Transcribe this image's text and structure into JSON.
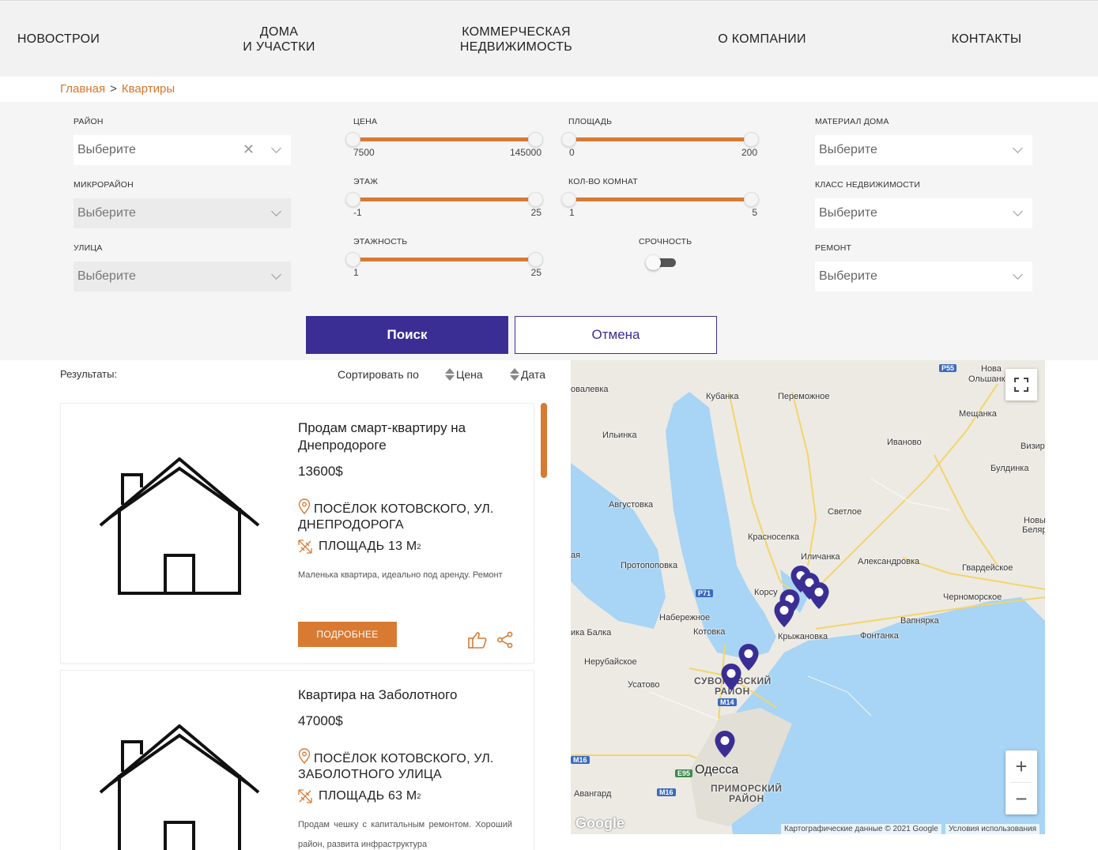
{
  "nav": {
    "items": [
      "НОВОСТРОИ",
      "ДОМА\nИ УЧАСТКИ",
      "КОММЕРЧЕСКАЯ\nНЕДВИЖИМОСТЬ",
      "О КОМПАНИИ",
      "КОНТАКТЫ"
    ]
  },
  "breadcrumb": {
    "home": "Главная",
    "sep": ">",
    "current": "Квартиры"
  },
  "filters": {
    "district": {
      "label": "РАЙОН",
      "value": "Выберите"
    },
    "microdistrict": {
      "label": "МИКРОРАЙОН",
      "value": "Выберите"
    },
    "street": {
      "label": "УЛИЦА",
      "value": "Выберите"
    },
    "price": {
      "label": "ЦЕНА",
      "min": "7500",
      "max": "145000"
    },
    "floor": {
      "label": "ЭТАЖ",
      "min": "-1",
      "max": "25"
    },
    "floors_total": {
      "label": "ЭТАЖНОСТЬ",
      "min": "1",
      "max": "25"
    },
    "area": {
      "label": "ПЛОЩАДЬ",
      "min": "0",
      "max": "200"
    },
    "rooms": {
      "label": "КОЛ-ВО КОМНАТ",
      "min": "1",
      "max": "5"
    },
    "urgent": {
      "label": "СРОЧНОСТЬ",
      "on": false
    },
    "material": {
      "label": "МАТЕРИАЛ ДОМА",
      "value": "Выберите"
    },
    "class": {
      "label": "КЛАСС НЕДВИЖИМОСТИ",
      "value": "Выберите"
    },
    "repair": {
      "label": "РЕМОНТ",
      "value": "Выберите"
    },
    "search_label": "Поиск",
    "cancel_label": "Отмена"
  },
  "results": {
    "label": "Результаты:",
    "sort_label": "Сортировать по",
    "sort_price": "Цена",
    "sort_date": "Дата",
    "accent": "#d97a33",
    "items": [
      {
        "title": "Продам смарт-квартиру на Днепродороге",
        "price": "13600$",
        "address": "ПОСЁЛОК КОТОВСКОГО, УЛ. ДНЕПРОДОРОГА",
        "area": "ПЛОЩАДЬ 13 М",
        "area_sup": "2",
        "desc": "Маленька квартира, идеально под аренду. Ремонт",
        "more": "ПОДРОБНЕЕ"
      },
      {
        "title": "Квартира на Заболотного",
        "price": "47000$",
        "address": "ПОСЁЛОК КОТОВСКОГО, УЛ. ЗАБОЛОТНОГО УЛИЦА",
        "area": "ПЛОЩАДЬ 63 М",
        "area_sup": "2",
        "desc": "Продам чешку с капитальным ремонтом. Хороший район, развита инфраструктура",
        "more": "ПОДРОБНЕЕ"
      }
    ]
  },
  "map": {
    "places": {
      "p55": "P55",
      "nova": "Нова",
      "olshanka": "Ольшанка",
      "valevka": "овалевка",
      "kubanka": "Кубанка",
      "peremozhnoe": "Переможное",
      "meshchanka": "Мещанка",
      "ilyinka": "Ильинка",
      "ivanovo": "Иваново",
      "vizir": "Визир",
      "buldinka": "Булдинка",
      "avgustovka": "Августовка",
      "svetloe": "Светлое",
      "novy": "Новы",
      "belyar": "Беляр",
      "krasnoselka": "Красноселка",
      "ilichanka": "Иличанка",
      "aleksandrovka": "Александровка",
      "aya": "ая",
      "protopopovka": "Протопоповка",
      "gvardeyskoe": "Гвардейское",
      "p71": "P71",
      "korsu": "Корсу",
      "chernomorskoe": "Черноморское",
      "naberezhnoe": "Набережное",
      "vapnyarka": "Вапнярка",
      "kotovka": "Котовка",
      "kryzhanovka": "Крыжановка",
      "fontanka": "Фонтанка",
      "balka": "ика Балка",
      "nerubayskoe": "Нерубайское",
      "suvorovsky": "СУВОРОВСКИЙ",
      "rayon1": "РАЙОН",
      "usatovo": "Усатово",
      "m14": "M14",
      "m16a": "M16",
      "odessa": "Одесса",
      "e95": "E95",
      "avangard": "Авангард",
      "m16b": "M16",
      "primorsky": "ПРИМОРСКИЙ",
      "rayon2": "РАЙОН"
    },
    "attribution": "Картографические данные © 2021 Google",
    "terms": "Условия использования",
    "google": "Google",
    "zoom_in": "+",
    "zoom_out": "−",
    "marker_color": "#3a2e94",
    "water_color": "#a8d4f5"
  }
}
